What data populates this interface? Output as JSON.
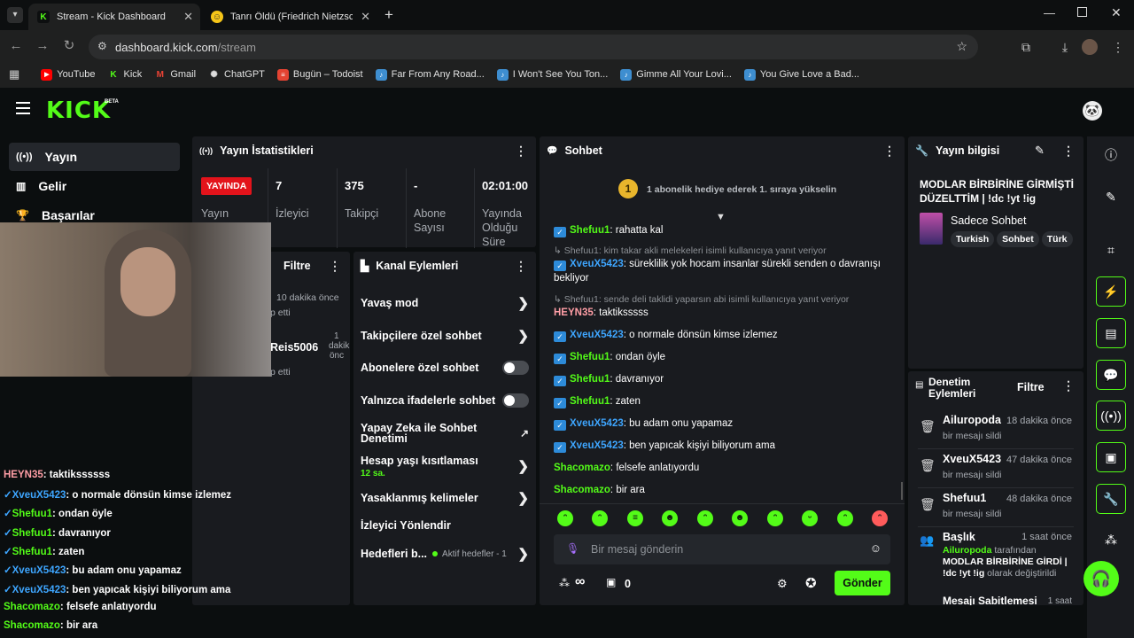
{
  "browser": {
    "tabs": [
      {
        "title": "Stream - Kick Dashboard",
        "active": true
      },
      {
        "title": "Tanrı Öldü (Friedrich Nietzsche",
        "active": false
      }
    ],
    "url_host": "dashboard.kick.com",
    "url_path": "/stream",
    "bookmarks": [
      "YouTube",
      "Kick",
      "Gmail",
      "ChatGPT",
      "Bugün – Todoist",
      "Far From Any Road...",
      "I Won't See You Ton...",
      "Gimme All Your Lovi...",
      "You Give Love a Bad..."
    ]
  },
  "kick": {
    "logo": "KICK",
    "logo_badge": "BETA",
    "sidebar": [
      {
        "label": "Yayın",
        "icon": "broadcast-icon"
      },
      {
        "label": "Gelir",
        "icon": "chart-icon"
      },
      {
        "label": "Başarılar",
        "icon": "trophy-icon"
      }
    ],
    "stats": {
      "title": "Yayın İstatistikleri",
      "live_badge": "YAYINDA",
      "live_label": "Yayın",
      "items": [
        {
          "value": "7",
          "label": "İzleyici"
        },
        {
          "value": "375",
          "label": "Takipçi"
        },
        {
          "value": "-",
          "label": "Abone Sayısı"
        },
        {
          "value": "02:01:00",
          "label": "Yayında Olduğu Süre"
        }
      ]
    },
    "hidden_panel": {
      "title": "Filtre",
      "rows": [
        {
          "time": "10 dakika önce",
          "text": "p etti"
        },
        {
          "user": "Reis5006",
          "time1": "1",
          "time2": "dakik",
          "time3": "önc",
          "text": "p etti"
        }
      ]
    },
    "channel_actions": {
      "title": "Kanal Eylemleri",
      "items": [
        {
          "label": "Yavaş mod",
          "control": "arrow"
        },
        {
          "label": "Takipçilere özel sohbet",
          "control": "arrow"
        },
        {
          "label": "Abonelere özel sohbet",
          "control": "toggle"
        },
        {
          "label": "Yalnızca ifadelerle sohbet",
          "control": "toggle"
        },
        {
          "label": "Yapay Zeka ile Sohbet Denetimi",
          "control": "external"
        },
        {
          "label": "Hesap yaşı kısıtlaması",
          "sub": "12 sa.",
          "control": "arrow"
        },
        {
          "label": "Yasaklanmış kelimeler",
          "control": "arrow"
        },
        {
          "label": "İzleyici Yönlendir",
          "control": "none"
        },
        {
          "label": "Hedefleri b...",
          "sub": "Aktif hedefler - 1",
          "control": "arrow"
        }
      ]
    },
    "chat": {
      "title": "Sohbet",
      "gift_rank": "1",
      "gift_text": "1 abonelik hediye ederek 1. sıraya yükselin",
      "messages": [
        {
          "user": "Shefuu1",
          "color": "#53fc18",
          "badge": true,
          "text": "rahatta kal"
        },
        {
          "reply": "Shefuu1: kim takar akli melekeleri isimli kullanıcıya yanıt veriyor"
        },
        {
          "user": "XveuX5423",
          "color": "#3ea6ff",
          "badge": true,
          "text": "süreklilik yok hocam insanlar sürekli senden o davranışı bekliyor"
        },
        {
          "reply": "Shefuu1: sende deli taklidi yaparsın abi isimli kullanıcıya yanıt veriyor"
        },
        {
          "user": "HEYN35",
          "color": "#ff9ea6",
          "badge": false,
          "text": "taktiksssss"
        },
        {
          "user": "XveuX5423",
          "color": "#3ea6ff",
          "badge": true,
          "text": "o normale dönsün kimse izlemez"
        },
        {
          "user": "Shefuu1",
          "color": "#53fc18",
          "badge": true,
          "text": "ondan öyle"
        },
        {
          "user": "Shefuu1",
          "color": "#53fc18",
          "badge": true,
          "text": "davranıyor"
        },
        {
          "user": "Shefuu1",
          "color": "#53fc18",
          "badge": true,
          "text": "zaten"
        },
        {
          "user": "XveuX5423",
          "color": "#3ea6ff",
          "badge": true,
          "text": "bu adam onu yapamaz"
        },
        {
          "user": "XveuX5423",
          "color": "#3ea6ff",
          "badge": true,
          "text": "ben yapıcak kişiyi biliyorum ama"
        },
        {
          "user": "Shacomazo",
          "color": "#53fc18",
          "badge": false,
          "text": "felsefe anlatıyordu"
        },
        {
          "user": "Shacomazo",
          "color": "#53fc18",
          "badge": false,
          "text": "bir ara"
        }
      ],
      "input_placeholder": "Bir mesaj gönderin",
      "points": "∞",
      "gifts_count": "0",
      "send_label": "Gönder"
    },
    "stream_info": {
      "title": "Yayın bilgisi",
      "stream_title": "MODLAR BİRBİRİNE GİRMİŞTİ DÜZELTTİM | !dc !yt !ig",
      "category": "Sadece Sohbet",
      "tags": [
        "Turkish",
        "Sohbet",
        "Türk"
      ]
    },
    "mod_actions": {
      "title": "Denetim Eylemleri",
      "filter": "Filtre",
      "items": [
        {
          "user": "Ailuropoda",
          "time": "18 dakika önce",
          "text": "bir mesajı sildi"
        },
        {
          "user": "XveuX5423",
          "time": "47 dakika önce",
          "text": "bir mesajı sildi"
        },
        {
          "user": "Shefuu1",
          "time": "48 dakika önce",
          "text": "bir mesajı sildi"
        }
      ],
      "title_change": {
        "label": "Başlık",
        "time": "1 saat önce",
        "by": "Ailuropoda",
        "by_suffix": "tarafından",
        "new_title": "MODLAR BİRBİRİNE GİRDİ | !dc !yt !ig",
        "suffix": "olarak değiştirildi"
      },
      "next_label": "Mesajı Sabitlemesi",
      "next_time": "1 saat"
    },
    "overlay_chat": [
      {
        "user": "HEYN35",
        "text": "taktikssssss",
        "color": "#ff9ea6",
        "badge": false
      },
      {
        "user": "XveuX5423",
        "text": "o normale dönsün kimse izlemez",
        "color": "#3ea6ff",
        "badge": true
      },
      {
        "user": "Shefuu1",
        "text": "ondan öyle",
        "color": "#53fc18",
        "badge": true
      },
      {
        "user": "Shefuu1",
        "text": "davranıyor",
        "color": "#53fc18",
        "badge": true
      },
      {
        "user": "Shefuu1",
        "text": "zaten",
        "color": "#53fc18",
        "badge": true
      },
      {
        "user": "XveuX5423",
        "text": "bu adam onu yapamaz",
        "color": "#3ea6ff",
        "badge": true
      },
      {
        "user": "XveuX5423",
        "text": "ben yapıcak kişiyi biliyorum ama",
        "color": "#3ea6ff",
        "badge": true
      },
      {
        "user": "Shacomazo",
        "text": "felsefe anlatıyordu",
        "color": "#53fc18",
        "badge": false
      },
      {
        "user": "Shacomazo",
        "text": "bir ara",
        "color": "#53fc18",
        "badge": false
      }
    ],
    "colors": {
      "accent": "#53fc18",
      "live": "#e3131b",
      "panel": "#191b1f"
    }
  }
}
